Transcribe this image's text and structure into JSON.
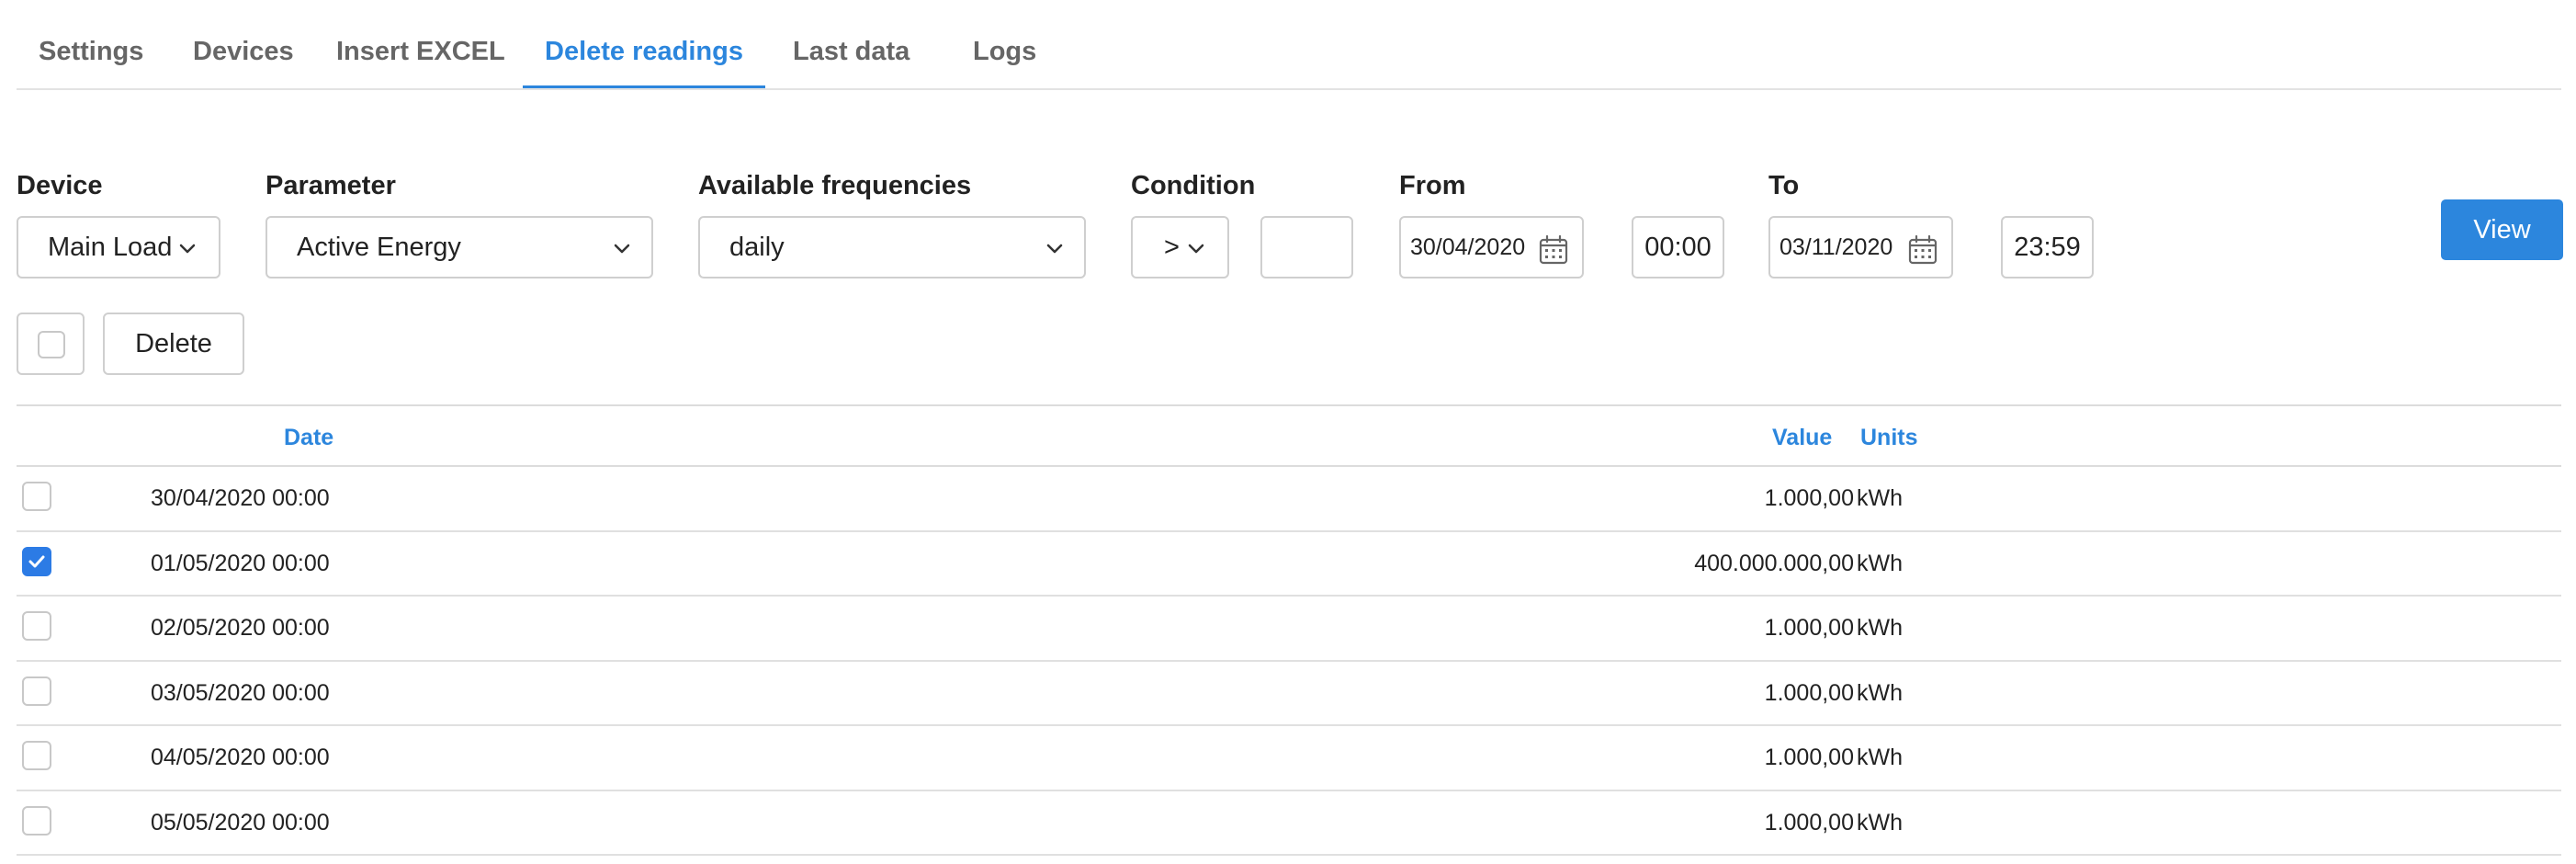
{
  "tabs": [
    {
      "label": "Settings",
      "active": false
    },
    {
      "label": "Devices",
      "active": false
    },
    {
      "label": "Insert EXCEL",
      "active": false
    },
    {
      "label": "Delete readings",
      "active": true
    },
    {
      "label": "Last data",
      "active": false
    },
    {
      "label": "Logs",
      "active": false
    }
  ],
  "filters": {
    "device": {
      "label": "Device",
      "value": "Main Load"
    },
    "parameter": {
      "label": "Parameter",
      "value": "Active Energy"
    },
    "frequency": {
      "label": "Available frequencies",
      "value": "daily"
    },
    "condition": {
      "label": "Condition",
      "operator": ">",
      "value": ""
    },
    "from": {
      "label": "From",
      "date": "30/04/2020",
      "time": "00:00"
    },
    "to": {
      "label": "To",
      "date": "03/11/2020",
      "time": "23:59"
    },
    "view_label": "View"
  },
  "actions": {
    "delete_label": "Delete"
  },
  "table": {
    "headers": {
      "date": "Date",
      "value": "Value",
      "units": "Units"
    },
    "rows": [
      {
        "date": "30/04/2020 00:00",
        "value": "1.000,00",
        "units": "kWh",
        "checked": false
      },
      {
        "date": "01/05/2020 00:00",
        "value": "400.000.000,00",
        "units": "kWh",
        "checked": true
      },
      {
        "date": "02/05/2020 00:00",
        "value": "1.000,00",
        "units": "kWh",
        "checked": false
      },
      {
        "date": "03/05/2020 00:00",
        "value": "1.000,00",
        "units": "kWh",
        "checked": false
      },
      {
        "date": "04/05/2020 00:00",
        "value": "1.000,00",
        "units": "kWh",
        "checked": false
      },
      {
        "date": "05/05/2020 00:00",
        "value": "1.000,00",
        "units": "kWh",
        "checked": false
      }
    ]
  },
  "colors": {
    "accent": "#2c86dd",
    "checkbox_checked": "#2c7be5"
  },
  "icons": {
    "select_chevron": "chevron-down-icon",
    "date_picker": "calendar-icon",
    "row_check": "checkmark-icon"
  }
}
